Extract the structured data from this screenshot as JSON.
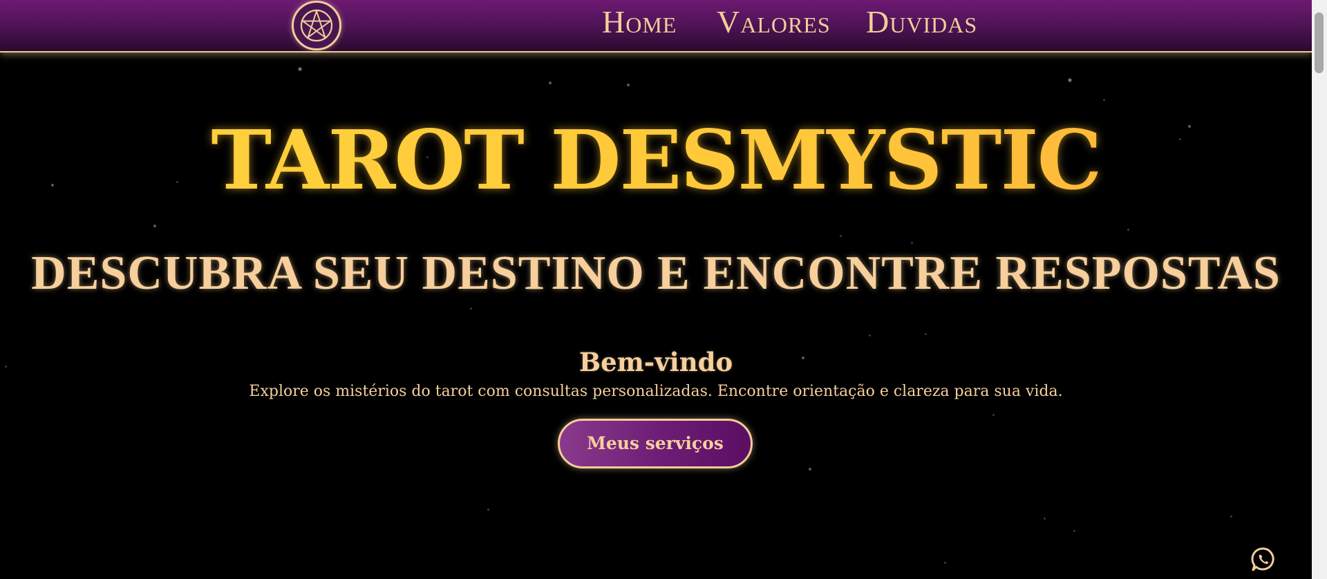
{
  "header": {
    "logo_icon": "pentagram-icon",
    "nav": [
      {
        "label": "Home"
      },
      {
        "label": "Valores"
      },
      {
        "label": "Duvidas"
      }
    ]
  },
  "hero": {
    "title": "TAROT DESMYSTIC",
    "subtitle": "DESCUBRA SEU DESTINO E ENCONTRE RESPOSTAS"
  },
  "welcome": {
    "heading": "Bem-vindo",
    "text": "Explore os mistérios do tarot com consultas personalizadas. Encontre orientação e clareza para sua vida.",
    "button_label": "Meus serviços"
  },
  "floating": {
    "whatsapp_icon": "whatsapp-icon"
  },
  "colors": {
    "header_purple": "#6d1a72",
    "gold": "#ffc738",
    "cream": "#f6cf9c",
    "background": "#000000"
  }
}
